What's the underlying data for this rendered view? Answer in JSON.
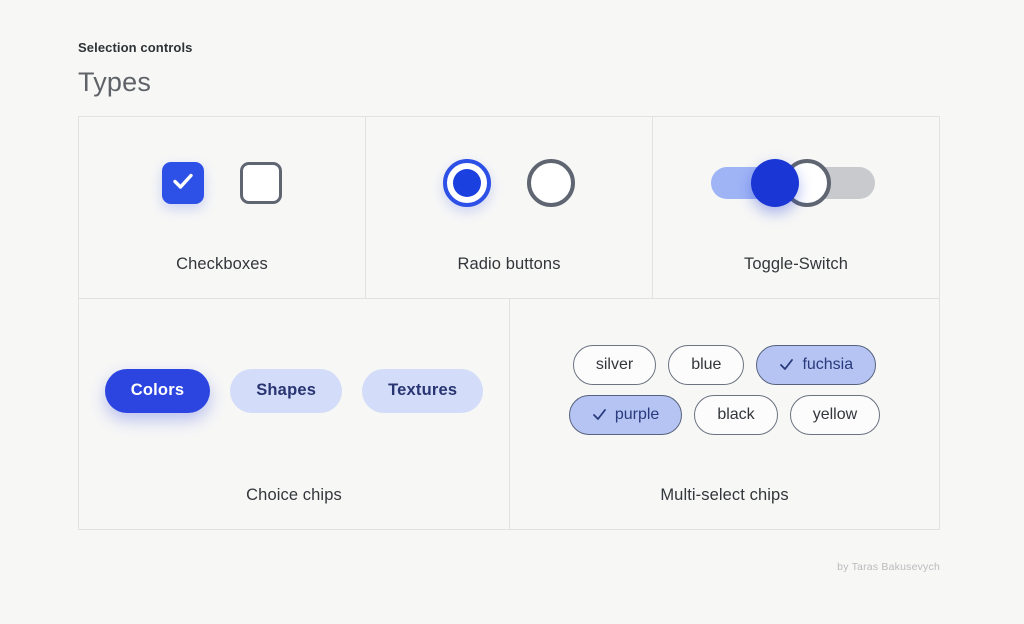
{
  "header": {
    "eyebrow": "Selection controls",
    "title": "Types"
  },
  "cards": {
    "checkboxes": {
      "label": "Checkboxes",
      "items": [
        {
          "state": "checked",
          "icon": "checkmark-icon"
        },
        {
          "state": "unchecked"
        }
      ]
    },
    "radios": {
      "label": "Radio buttons",
      "items": [
        {
          "state": "selected"
        },
        {
          "state": "unselected"
        }
      ]
    },
    "toggles": {
      "label": "Toggle-Switch",
      "items": [
        {
          "state": "on"
        },
        {
          "state": "off"
        }
      ]
    },
    "choice_chips": {
      "label": "Choice chips",
      "chips": [
        {
          "label": "Colors",
          "selected": true
        },
        {
          "label": "Shapes",
          "selected": false
        },
        {
          "label": "Textures",
          "selected": false
        }
      ]
    },
    "multi_select_chips": {
      "label": "Multi-select chips",
      "rows": [
        [
          {
            "label": "silver",
            "selected": false
          },
          {
            "label": "blue",
            "selected": false
          },
          {
            "label": "fuchsia",
            "selected": true,
            "icon": "checkmark-icon"
          }
        ],
        [
          {
            "label": "purple",
            "selected": true,
            "icon": "checkmark-icon"
          },
          {
            "label": "black",
            "selected": false
          },
          {
            "label": "yellow",
            "selected": false
          }
        ]
      ]
    }
  },
  "footer": {
    "credit": "by Taras Bakusevych"
  },
  "colors": {
    "background": "#f7f7f6",
    "accent_blue": "#2d50e6",
    "accent_blue_dark": "#1a36d4",
    "chip_light": "#d3dcf8",
    "chip_selected": "#b5c4f2",
    "track_on": "#9fb4f5",
    "track_off": "#c8cace",
    "border_gray": "#5f6672",
    "card_border": "#e2e2e1",
    "text_dark": "#33363a",
    "text_navy": "#283572",
    "footer_text": "#b9bbbd"
  }
}
